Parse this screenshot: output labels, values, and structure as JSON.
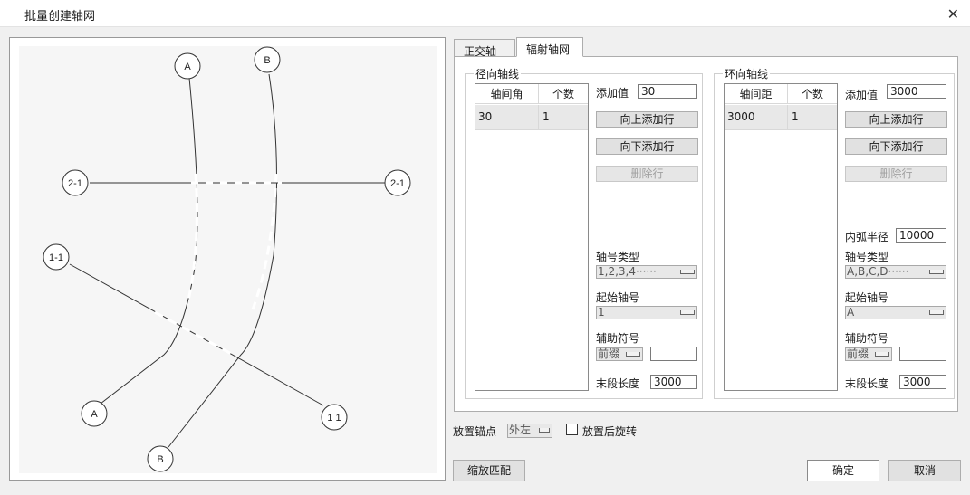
{
  "window": {
    "title": "批量创建轴网",
    "close_icon": "close-icon"
  },
  "preview": {
    "labels": {
      "a_top": "A",
      "b_top": "B",
      "c21_left": "2-1",
      "c21_right": "2-1",
      "c11_left": "1-1",
      "a_bottom": "A",
      "c11_bottom": "1 1",
      "b_bottom": "B"
    }
  },
  "tabs": [
    {
      "label": "正交轴网",
      "active": false
    },
    {
      "label": "辐射轴网",
      "active": true
    }
  ],
  "radial": {
    "legend": "径向轴线",
    "columns": [
      "轴间角",
      "个数"
    ],
    "rows": [
      {
        "c1": "30",
        "c2": "1"
      }
    ],
    "add_value_label": "添加值",
    "add_value": "30",
    "add_above": "向上添加行",
    "add_below": "向下添加行",
    "delete_row": "删除行",
    "axis_type_label": "轴号类型",
    "axis_type_value": "1,2,3,4······",
    "start_label": "起始轴号",
    "start_value": "1",
    "aux_label": "辅助符号",
    "aux_value": "前缀",
    "aux_text": "",
    "end_len_label": "末段长度",
    "end_len_value": "3000"
  },
  "ring": {
    "legend": "环向轴线",
    "columns": [
      "轴间距",
      "个数"
    ],
    "rows": [
      {
        "c1": "3000",
        "c2": "1"
      }
    ],
    "add_value_label": "添加值",
    "add_value": "3000",
    "add_above": "向上添加行",
    "add_below": "向下添加行",
    "delete_row": "删除行",
    "inner_radius_label": "内弧半径",
    "inner_radius_value": "10000",
    "axis_type_label": "轴号类型",
    "axis_type_value": "A,B,C,D······",
    "start_label": "起始轴号",
    "start_value": "A",
    "aux_label": "辅助符号",
    "aux_value": "前缀",
    "aux_text": "",
    "end_len_label": "末段长度",
    "end_len_value": "3000"
  },
  "anchor": {
    "label": "放置锚点",
    "value": "外左"
  },
  "rotate": {
    "label": "放置后旋转",
    "checked": false
  },
  "buttons": {
    "zoom_fit": "缩放匹配",
    "ok": "确定",
    "cancel": "取消"
  }
}
